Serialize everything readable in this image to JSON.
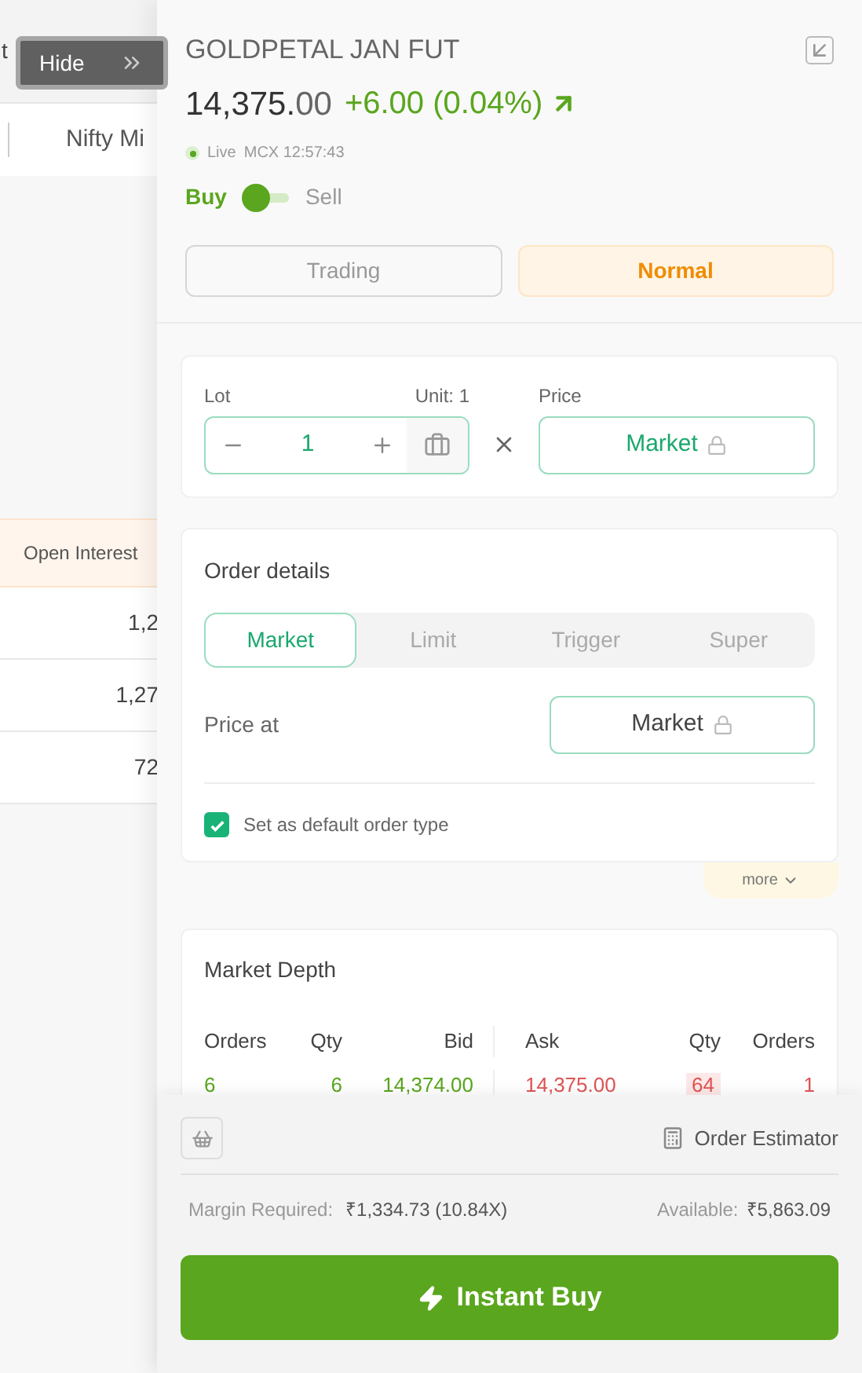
{
  "background": {
    "top_text": "t",
    "tab": "Nifty Mi",
    "column_header": "Open Interest",
    "rows": [
      "1,2",
      "1,27",
      "72"
    ]
  },
  "hide_button": {
    "label": "Hide"
  },
  "instrument": {
    "title": "GOLDPETAL JAN FUT",
    "price_main": "14,375.",
    "price_decimals": "00",
    "change": "+6.00 (0.04%)",
    "status": "Live",
    "exchange_time": "MCX 12:57:43"
  },
  "side_toggle": [
    {
      "label": "Buy",
      "selected": true
    },
    {
      "label": "Sell",
      "selected": false
    }
  ],
  "product_tabs": [
    {
      "label": "Trading",
      "selected": false
    },
    {
      "label": "Normal",
      "selected": true
    }
  ],
  "lot": {
    "label": "Lot",
    "unit": "Unit: 1",
    "value": "1"
  },
  "price": {
    "label": "Price",
    "value": "Market"
  },
  "order_details": {
    "title": "Order details",
    "tabs": [
      {
        "label": "Market",
        "selected": true
      },
      {
        "label": "Limit",
        "selected": false
      },
      {
        "label": "Trigger",
        "selected": false
      },
      {
        "label": "Super",
        "selected": false
      }
    ],
    "price_at_label": "Price at",
    "price_at_value": "Market",
    "default_checkbox": {
      "label": "Set as default order type",
      "checked": true
    }
  },
  "more": "more",
  "market_depth": {
    "title": "Market Depth",
    "columns": [
      "Orders",
      "Qty",
      "Bid",
      "Ask",
      "Qty",
      "Orders"
    ],
    "rows": [
      [
        "6",
        "6",
        "14,374.00",
        "14,375.00",
        "64",
        "1"
      ]
    ]
  },
  "footer": {
    "estimator": "Order Estimator",
    "margin_label": "Margin Required:",
    "margin_value": "₹1,334.73 (10.84X)",
    "available_label": "Available:",
    "available_value": "₹5,863.09",
    "action": "Instant Buy"
  }
}
